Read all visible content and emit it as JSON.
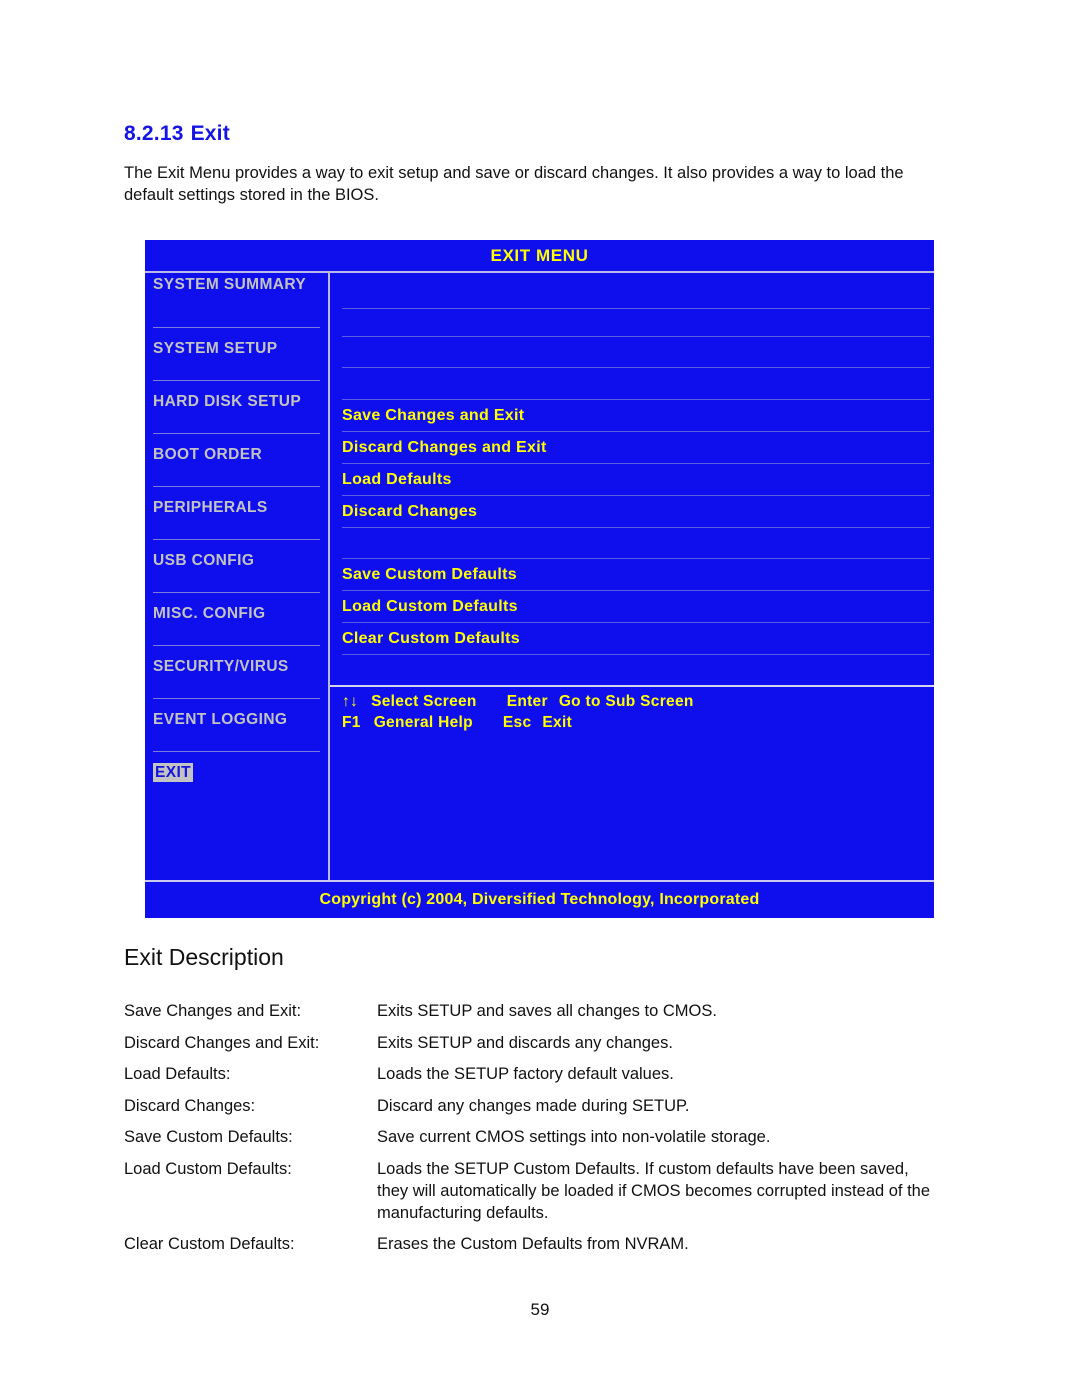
{
  "document": {
    "heading_number": "8.2.13",
    "heading_title": "Exit",
    "intro": "The Exit Menu provides a way to exit setup and save or discard changes.  It also provides a way to load the default settings stored in the BIOS.",
    "section_title": "Exit Description",
    "page_number": "59"
  },
  "bios": {
    "title": "EXIT MENU",
    "copyright": "Copyright (c) 2004, Diversified Technology, Incorporated",
    "sidebar": [
      {
        "label": "SYSTEM SUMMARY",
        "selected": false
      },
      {
        "label": "SYSTEM SETUP",
        "selected": false
      },
      {
        "label": "HARD DISK SETUP",
        "selected": false
      },
      {
        "label": "BOOT ORDER",
        "selected": false
      },
      {
        "label": "PERIPHERALS",
        "selected": false
      },
      {
        "label": "USB CONFIG",
        "selected": false
      },
      {
        "label": "MISC. CONFIG",
        "selected": false
      },
      {
        "label": "SECURITY/VIRUS",
        "selected": false
      },
      {
        "label": "EVENT LOGGING",
        "selected": false
      },
      {
        "label": "EXIT",
        "selected": true
      }
    ],
    "menu_group_1": [
      "Save Changes and Exit",
      "Discard Changes and Exit",
      "Load Defaults",
      "Discard Changes"
    ],
    "menu_group_2": [
      "Save Custom Defaults",
      "Load Custom Defaults",
      "Clear Custom Defaults"
    ],
    "help": {
      "arrows": "↑↓",
      "select_screen": "Select Screen",
      "enter_key": "Enter",
      "enter_action": "Go to Sub Screen",
      "f1_key": "F1",
      "f1_action": "General Help",
      "esc_key": "Esc",
      "esc_action": "Exit"
    },
    "colors": {
      "background": "#0f0fee",
      "menu_text": "#ffff00",
      "sidebar_text": "#c3c3c3",
      "selected_bg": "#c3c3c3",
      "selected_text": "#1414dd",
      "rule": "#5d5de4"
    }
  },
  "descriptions": [
    {
      "term": "Save Changes and Exit:",
      "definition": "Exits SETUP and saves all changes to CMOS."
    },
    {
      "term": "Discard Changes and Exit:",
      "definition": "Exits SETUP and discards any changes."
    },
    {
      "term": "Load Defaults:",
      "definition": "Loads the SETUP factory default values."
    },
    {
      "term": "Discard Changes:",
      "definition": "Discard any changes made during SETUP."
    },
    {
      "term": "Save Custom Defaults:",
      "definition": "Save current CMOS settings into non-volatile storage."
    },
    {
      "term": "Load Custom Defaults:",
      "definition": "Loads the SETUP Custom Defaults.  If custom defaults have been saved, they will automatically be loaded if CMOS becomes corrupted instead of the manufacturing defaults."
    },
    {
      "term": "Clear Custom Defaults:",
      "definition": "Erases the Custom Defaults from NVRAM."
    }
  ]
}
